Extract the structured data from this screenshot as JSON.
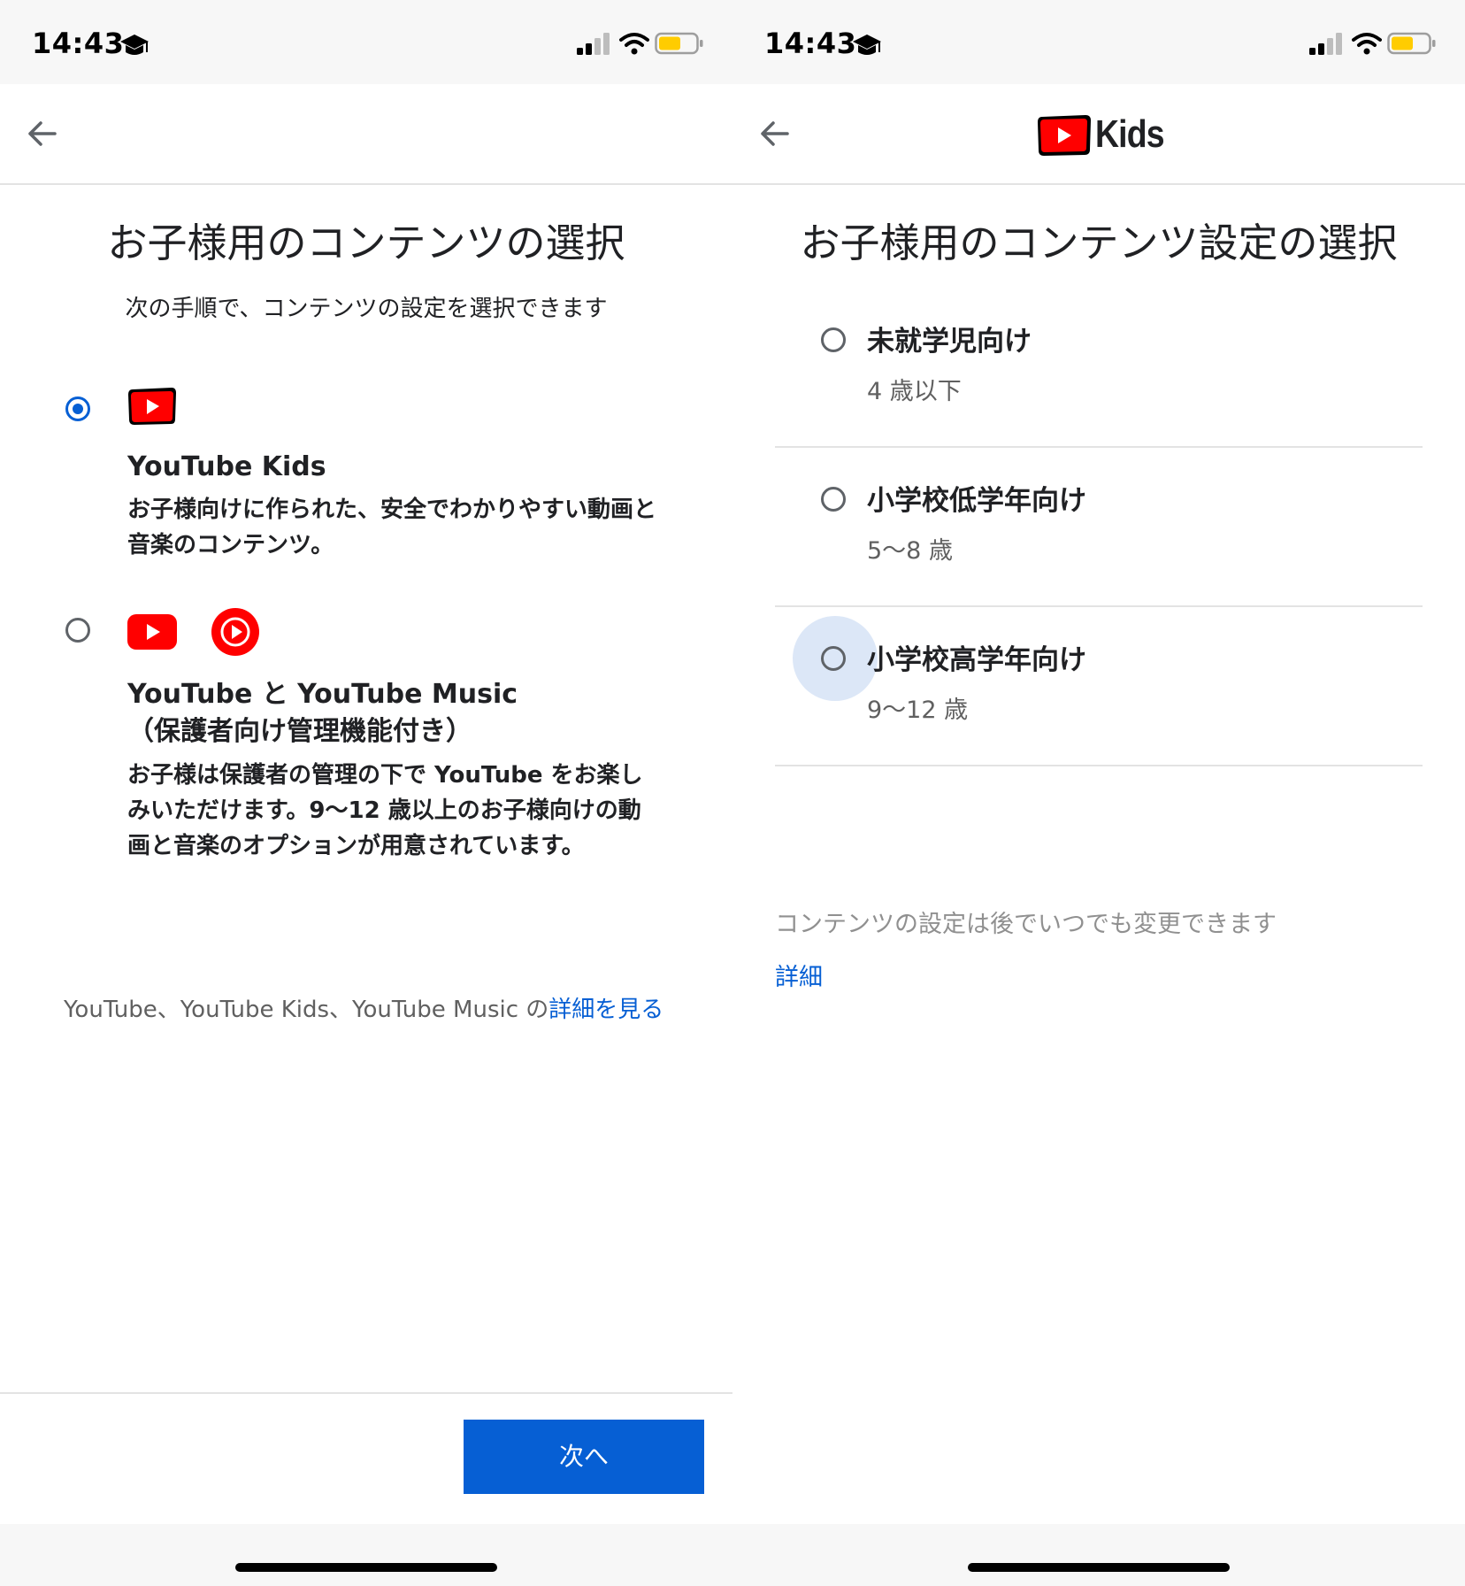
{
  "status": {
    "time": "14:43"
  },
  "left": {
    "title": "お子様用のコンテンツの選択",
    "subtitle": "次の手順で、コンテンツの設定を選択できます",
    "options": [
      {
        "heading": "YouTube Kids",
        "description": "お子様向けに作られた、安全でわかりやすい動画と音楽のコンテンツ。",
        "selected": true
      },
      {
        "heading_line1": "YouTube と YouTube Music",
        "heading_line2": "（保護者向け管理機能付き）",
        "description": "お子様は保護者の管理の下で YouTube をお楽しみいただけます。9〜12 歳以上のお子様向けの動画と音楽のオプションが用意されています。",
        "selected": false
      }
    ],
    "footnote_prefix": "YouTube、YouTube Kids、YouTube Music の",
    "footnote_link": "詳細を見る",
    "next_button": "次へ"
  },
  "right": {
    "logo_text": "Kids",
    "title": "お子様用のコンテンツ設定の選択",
    "age_options": [
      {
        "label": "未就学児向け",
        "age": "4 歳以下"
      },
      {
        "label": "小学校低学年向け",
        "age": "5〜8 歳"
      },
      {
        "label": "小学校高学年向け",
        "age": "9〜12 歳"
      }
    ],
    "note": "コンテンツの設定は後でいつでも変更できます",
    "details_link": "詳細"
  },
  "colors": {
    "accent": "#065fd4",
    "youtube_red": "#ff0000",
    "battery": "#ffcc00"
  }
}
